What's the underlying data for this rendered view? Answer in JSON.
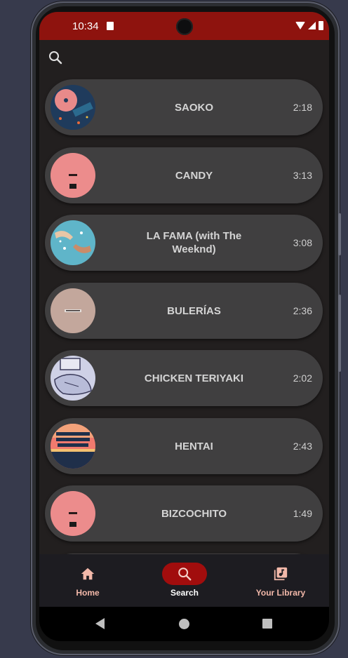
{
  "status_bar": {
    "time": "10:34"
  },
  "search": {
    "icon": "search-icon"
  },
  "songs": [
    {
      "title": "SAOKO",
      "duration": "2:18",
      "cover": "turntable-pink-blue"
    },
    {
      "title": "CANDY",
      "duration": "3:13",
      "cover": "pink-minimal"
    },
    {
      "title": "LA FAMA (with The Weeknd)",
      "duration": "3:08",
      "cover": "hands-teal"
    },
    {
      "title": "BULERÍAS",
      "duration": "2:36",
      "cover": "beige-minimal"
    },
    {
      "title": "CHICKEN TERIYAKI",
      "duration": "2:02",
      "cover": "sketch-lavender"
    },
    {
      "title": "HENTAI",
      "duration": "2:43",
      "cover": "summer-2021-sunset"
    },
    {
      "title": "BIZCOCHITO",
      "duration": "1:49",
      "cover": "pink-minimal"
    }
  ],
  "bottom_nav": {
    "items": [
      {
        "label": "Home",
        "icon": "home-icon",
        "active": false
      },
      {
        "label": "Search",
        "icon": "search-icon",
        "active": true
      },
      {
        "label": "Your Library",
        "icon": "library-music-icon",
        "active": false
      }
    ]
  },
  "colors": {
    "status_bar": "#8e130e",
    "background": "#221f1f",
    "card": "#403f40",
    "nav_active_pill": "#a10d0d",
    "nav_label": "#f2b8a9"
  }
}
